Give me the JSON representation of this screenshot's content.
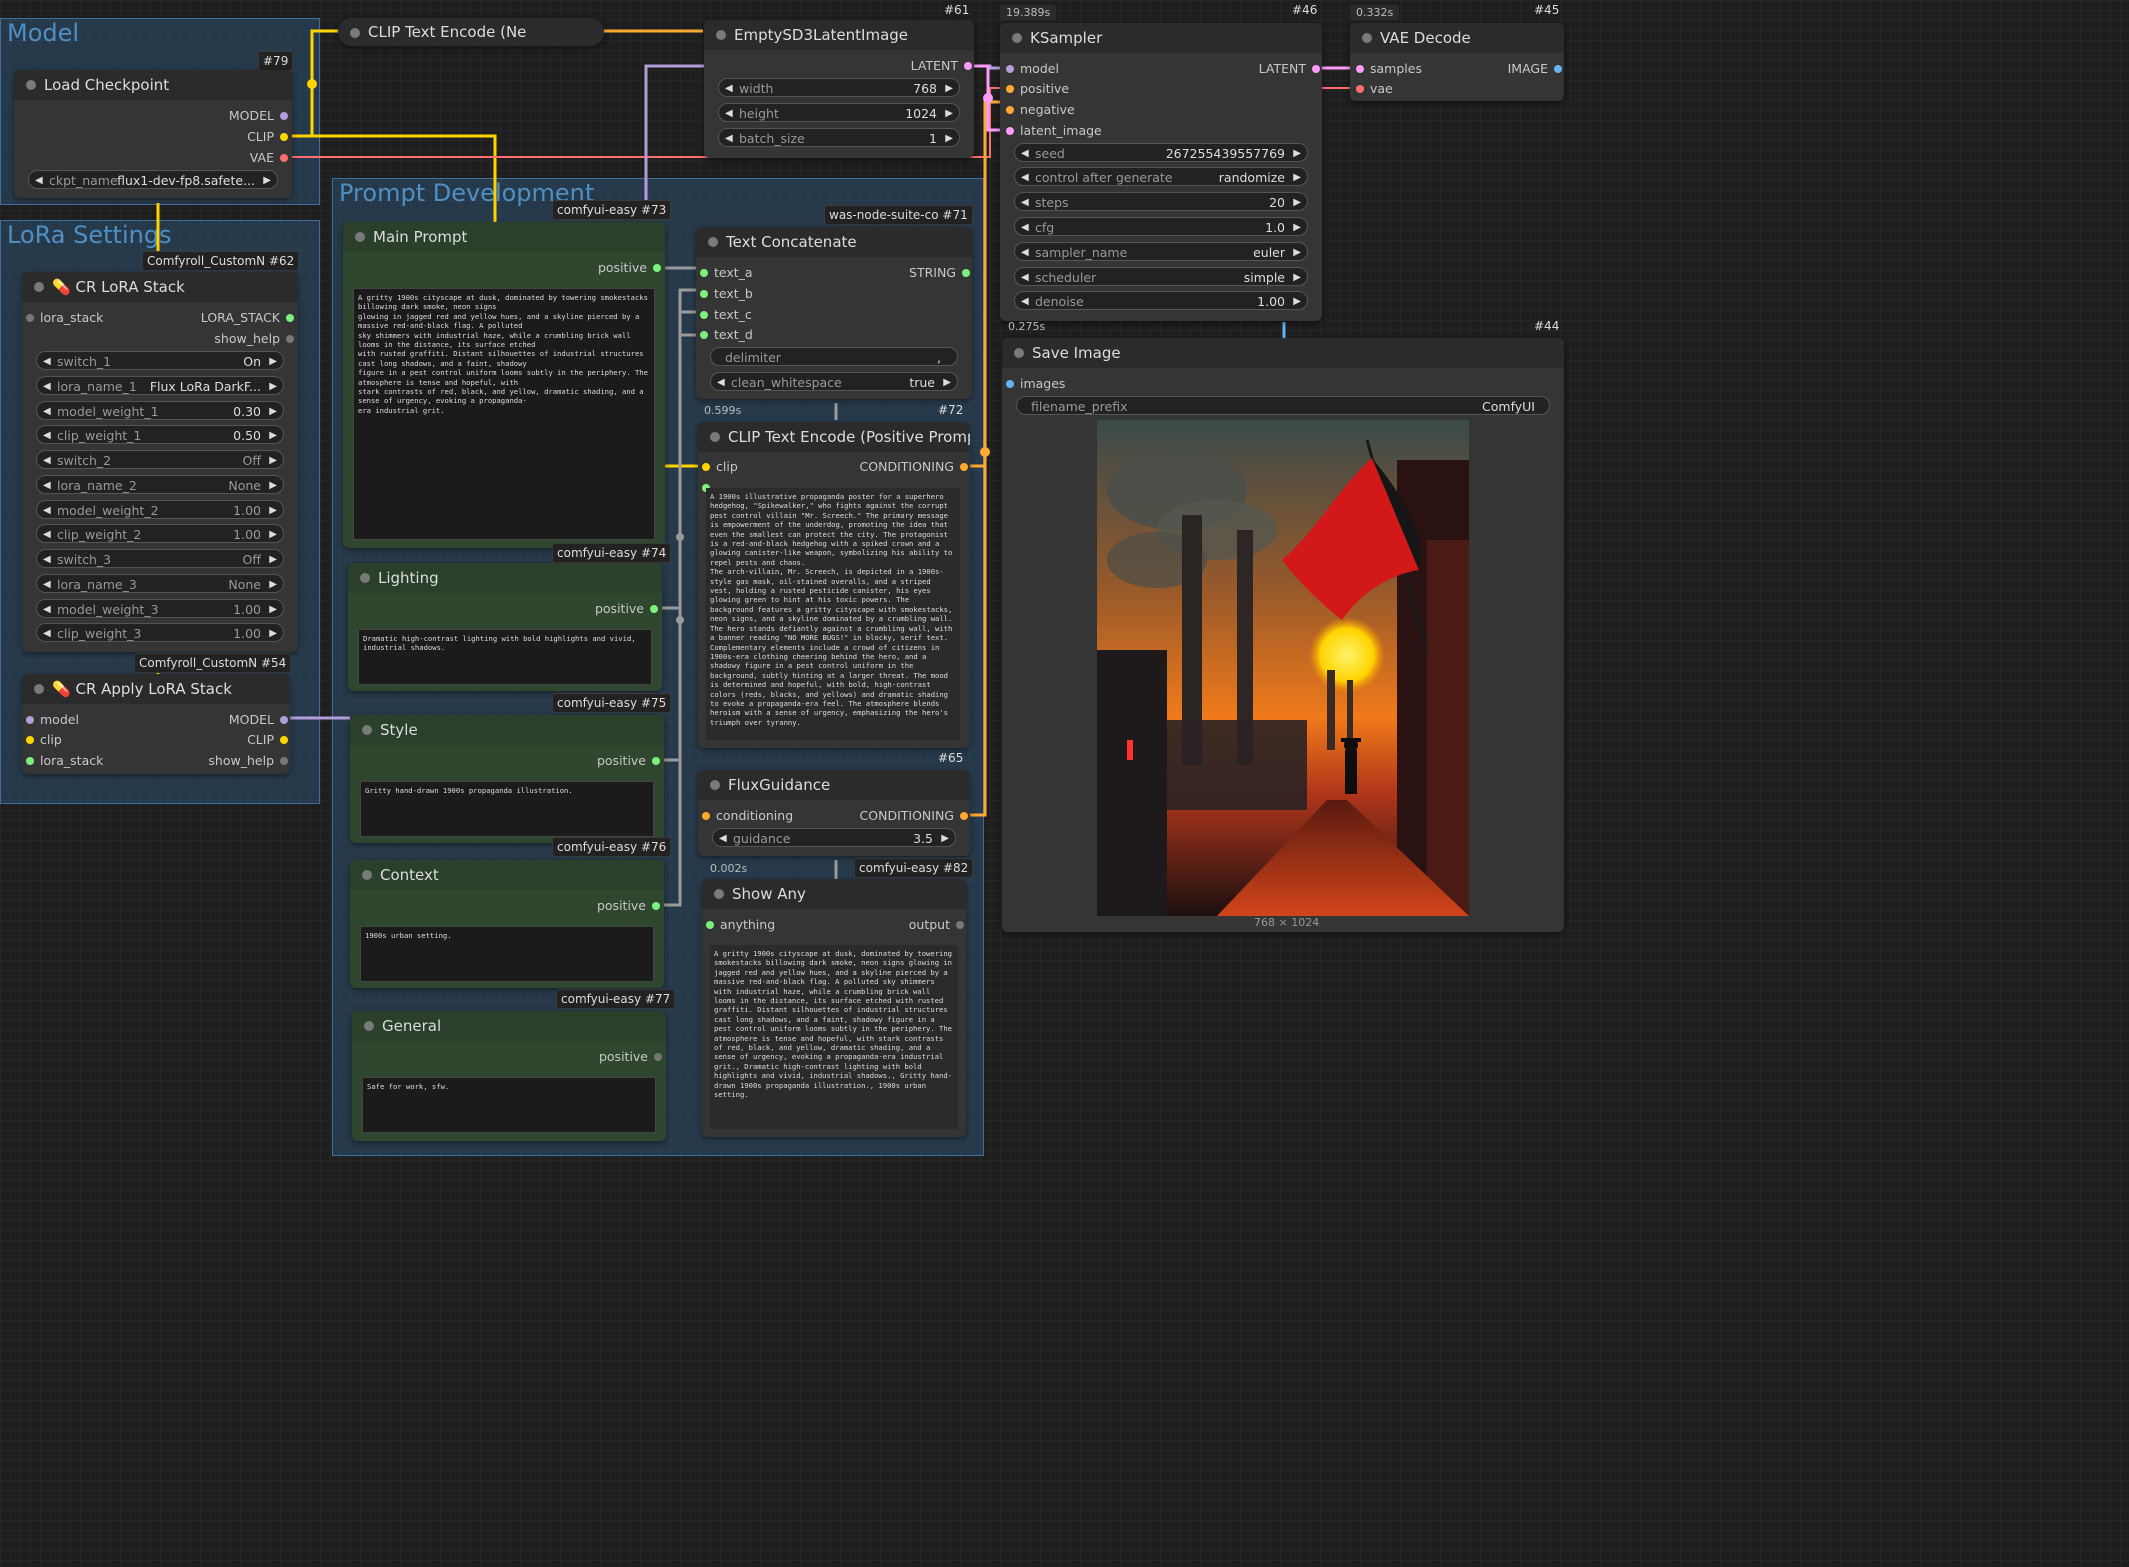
{
  "groups": {
    "model": "Model",
    "lora": "LoRa Settings",
    "prompt": "Prompt Development"
  },
  "colors": {
    "clip": "#ffd500",
    "vae": "#ff6e6e",
    "model": "#b39ddb",
    "latent": "#ff9cf9",
    "conditioning": "#ffa931",
    "string": "#7ef07e",
    "image": "#64b5f6",
    "group": "#3f6f9a"
  },
  "nodes": {
    "clip_text_neg": {
      "title": "CLIP Text Encode (Ne"
    },
    "load_checkpoint": {
      "id": "#79",
      "title": "Load Checkpoint",
      "outputs": [
        "MODEL",
        "CLIP",
        "VAE"
      ],
      "ckpt_label": "ckpt_name",
      "ckpt_value": "flux1-dev-fp8.safete..."
    },
    "empty_latent": {
      "id": "#61",
      "title": "EmptySD3LatentImage",
      "output": "LATENT",
      "width_label": "width",
      "width": "768",
      "height_label": "height",
      "height": "1024",
      "batch_label": "batch_size",
      "batch": "1"
    },
    "ksampler": {
      "id": "#46",
      "time": "19.389s",
      "title": "KSampler",
      "inputs": [
        "model",
        "positive",
        "negative",
        "latent_image"
      ],
      "output": "LATENT",
      "widgets": [
        {
          "label": "seed",
          "value": "267255439557769"
        },
        {
          "label": "control after generate",
          "value": "randomize"
        },
        {
          "label": "steps",
          "value": "20"
        },
        {
          "label": "cfg",
          "value": "1.0"
        },
        {
          "label": "sampler_name",
          "value": "euler"
        },
        {
          "label": "scheduler",
          "value": "simple"
        },
        {
          "label": "denoise",
          "value": "1.00"
        }
      ]
    },
    "vae_decode": {
      "id": "#45",
      "time": "0.332s",
      "title": "VAE Decode",
      "inputs": [
        "samples",
        "vae"
      ],
      "output": "IMAGE"
    },
    "cr_lora_stack": {
      "id": "#62",
      "pack": "Comfyroll_CustomN",
      "title": "CR LoRA Stack",
      "input": "lora_stack",
      "outputs": [
        "LORA_STACK",
        "show_help"
      ],
      "widgets": [
        {
          "label": "switch_1",
          "value": "On"
        },
        {
          "label": "lora_name_1",
          "value": "Flux LoRa DarkF..."
        },
        {
          "label": "model_weight_1",
          "value": "0.30"
        },
        {
          "label": "clip_weight_1",
          "value": "0.50"
        },
        {
          "label": "switch_2",
          "value": "Off"
        },
        {
          "label": "lora_name_2",
          "value": "None"
        },
        {
          "label": "model_weight_2",
          "value": "1.00"
        },
        {
          "label": "clip_weight_2",
          "value": "1.00"
        },
        {
          "label": "switch_3",
          "value": "Off"
        },
        {
          "label": "lora_name_3",
          "value": "None"
        },
        {
          "label": "model_weight_3",
          "value": "1.00"
        },
        {
          "label": "clip_weight_3",
          "value": "1.00"
        }
      ]
    },
    "cr_apply_lora": {
      "id": "#54",
      "pack": "Comfyroll_CustomN",
      "title": "CR Apply LoRA Stack",
      "inputs": [
        "model",
        "clip",
        "lora_stack"
      ],
      "outputs": [
        "MODEL",
        "CLIP",
        "show_help"
      ]
    },
    "main_prompt": {
      "id": "#73",
      "pack": "comfyui-easy",
      "title": "Main Prompt",
      "output": "positive",
      "text": "A gritty 1900s cityscape at dusk, dominated by towering smokestacks billowing dark smoke, neon signs\nglowing in jagged red and yellow hues, and a skyline pierced by a massive red-and-black flag. A polluted\nsky shimmers with industrial haze, while a crumbling brick wall looms in the distance, its surface etched\nwith rusted graffiti. Distant silhouettes of industrial structures cast long shadows, and a faint, shadowy\nfigure in a pest control uniform looms subtly in the periphery. The atmosphere is tense and hopeful, with\nstark contrasts of red, black, and yellow, dramatic shading, and a sense of urgency, evoking a propaganda-\nera industrial grit."
    },
    "lighting": {
      "id": "#74",
      "pack": "comfyui-easy",
      "title": "Lighting",
      "output": "positive",
      "text": "Dramatic high-contrast lighting with bold highlights and vivid, industrial shadows."
    },
    "style": {
      "id": "#75",
      "pack": "comfyui-easy",
      "title": "Style",
      "output": "positive",
      "text": "Gritty hand-drawn 1900s propaganda illustration."
    },
    "context": {
      "id": "#76",
      "pack": "comfyui-easy",
      "title": "Context",
      "output": "positive",
      "text": "1900s urban setting."
    },
    "general": {
      "id": "#77",
      "pack": "comfyui-easy",
      "title": "General",
      "output": "positive",
      "text": "Safe for work, sfw."
    },
    "text_concat": {
      "id": "#71",
      "pack": "was-node-suite-co",
      "title": "Text Concatenate",
      "inputs": [
        "text_a",
        "text_b",
        "text_c",
        "text_d"
      ],
      "output": "STRING",
      "delim_label": "delimiter",
      "delim_value": ",",
      "clean_label": "clean_whitespace",
      "clean_value": "true"
    },
    "clip_text_pos": {
      "id": "#72",
      "time": "0.599s",
      "title": "CLIP Text Encode (Positive Prompt)",
      "input": "clip",
      "output": "CONDITIONING",
      "text": "A 1900s illustrative propaganda poster for a superhero hedgehog, \"Spikewalker,\" who fights against the corrupt pest control villain \"Mr. Screech.\" The primary message is empowerment of the underdog, promoting the idea that even the smallest can protect the city. The protagonist is a red-and-black hedgehog with a spiked crown and a glowing canister-like weapon, symbolizing his ability to repel pests and chaos.\nThe arch-villain, Mr. Screech, is depicted in a 1900s-style gas mask, oil-stained overalls, and a striped vest, holding a rusted pesticide canister, his eyes glowing green to hint at his toxic powers. The background features a gritty cityscape with smokestacks, neon signs, and a skyline dominated by a crumbling wall.\nThe hero stands defiantly against a crumbling wall, with a banner reading \"NO MORE BUGS!\" in blocky, serif text. Complementary elements include a crowd of citizens in 1900s-era clothing cheering behind the hero, and a shadowy figure in a pest control uniform in the background, subtly hinting at a larger threat. The mood is determined and hopeful, with bold, high-contrast colors (reds, blacks, and yellows) and dramatic shading to evoke a propaganda-era feel. The atmosphere blends heroism with a sense of urgency, emphasizing the hero's triumph over tyranny."
    },
    "flux_guidance": {
      "id": "#65",
      "title": "FluxGuidance",
      "input": "conditioning",
      "output": "CONDITIONING",
      "guidance_label": "guidance",
      "guidance_value": "3.5"
    },
    "show_any": {
      "id": "#82",
      "pack": "comfyui-easy",
      "time": "0.002s",
      "title": "Show Any",
      "input": "anything",
      "output": "output",
      "text": "A gritty 1900s cityscape at dusk, dominated by towering smokestacks billowing dark smoke, neon signs glowing in jagged red and yellow hues, and a skyline pierced by a massive red-and-black flag. A polluted sky shimmers with industrial haze, while a crumbling brick wall looms in the distance, its surface etched with rusted graffiti. Distant silhouettes of industrial structures cast long shadows, and a faint, shadowy figure in a pest control uniform looms subtly in the periphery. The atmosphere is tense and hopeful, with stark contrasts of red, black, and yellow, dramatic shading, and a sense of urgency, evoking a propaganda-era industrial grit., Dramatic high-contrast lighting with bold highlights and vivid, industrial shadows., Gritty hand-drawn 1900s propaganda illustration., 1900s urban setting."
    },
    "save_image": {
      "id": "#44",
      "time": "0.275s",
      "title": "Save Image",
      "input": "images",
      "prefix_label": "filename_prefix",
      "prefix_value": "ComfyUI",
      "image_size": "768 × 1024"
    }
  }
}
